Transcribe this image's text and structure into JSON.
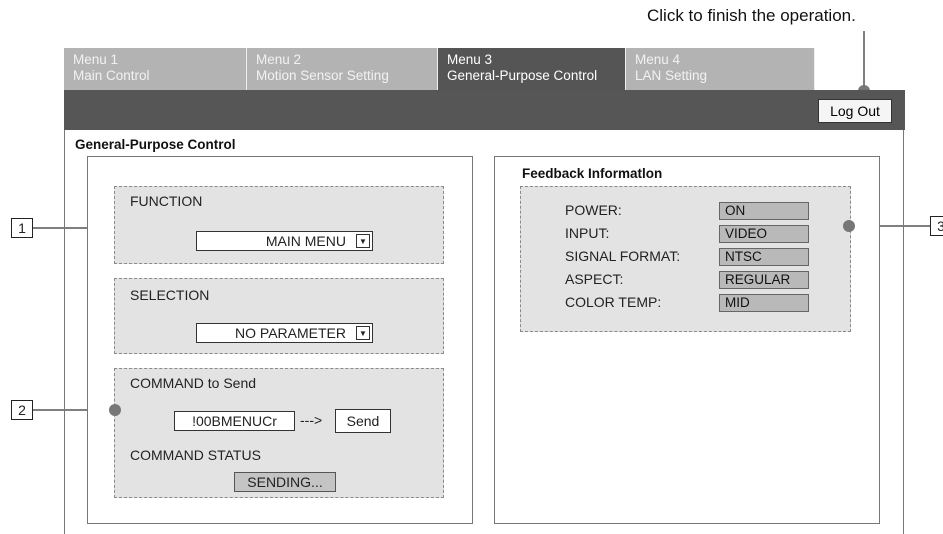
{
  "annotation": {
    "text": "Click to finish the operation."
  },
  "tabs": [
    {
      "line1": "Menu 1",
      "line2": "Main Control"
    },
    {
      "line1": "Menu 2",
      "line2": "Motion Sensor Setting"
    },
    {
      "line1": "Menu 3",
      "line2": "General-Purpose Control"
    },
    {
      "line1": "Menu 4",
      "line2": "LAN Setting"
    }
  ],
  "header": {
    "logout_label": "Log Out"
  },
  "page": {
    "title": "General-Purpose Control"
  },
  "left": {
    "function_label": "FUNCTION",
    "function_value": "MAIN MENU",
    "selection_label": "SELECTION",
    "selection_value": "NO PARAMETER",
    "command_label": "COMMAND to Send",
    "command_value": "!00BMENUCr",
    "arrow_text": "--->",
    "send_label": "Send",
    "status_label": "COMMAND STATUS",
    "status_value": "SENDING..."
  },
  "feedback": {
    "title": "Feedback Informatlon",
    "items": [
      {
        "label": "POWER:",
        "value": "ON"
      },
      {
        "label": "INPUT:",
        "value": "VIDEO"
      },
      {
        "label": "SIGNAL FORMAT:",
        "value": "NTSC"
      },
      {
        "label": "ASPECT:",
        "value": "REGULAR"
      },
      {
        "label": "COLOR TEMP:",
        "value": "MID"
      }
    ]
  },
  "callouts": [
    "1",
    "2",
    "3"
  ],
  "icons": {
    "dropdown": "chevron-down-icon",
    "callout_dot": "callout-dot-icon"
  }
}
